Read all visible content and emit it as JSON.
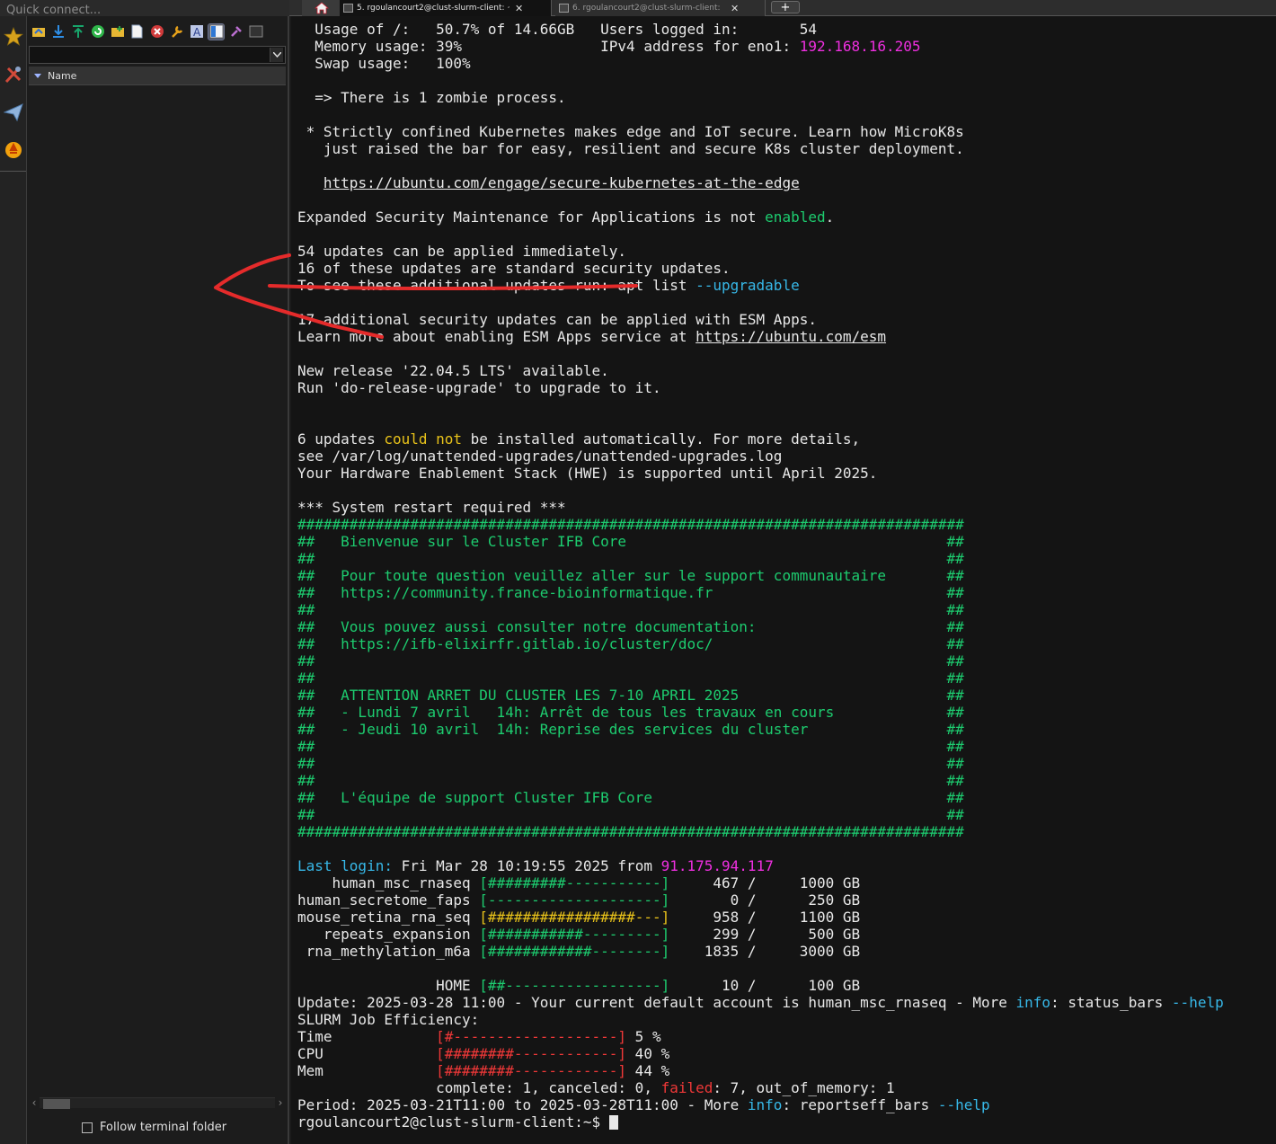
{
  "quick_connect": {
    "placeholder": "Quick connect..."
  },
  "tabs": [
    {
      "label": "5. rgoulancourt2@clust-slurm-client: ~",
      "close": "✕",
      "active": true
    },
    {
      "label": "6. rgoulancourt2@clust-slurm-client:",
      "close": "✕",
      "active": false
    }
  ],
  "new_tab_label": "+",
  "sidebar": {
    "file_list_header": "Name",
    "follow_terminal_folder": "Follow terminal folder",
    "scroll_left": "‹",
    "scroll_right": "›"
  },
  "colors": {
    "annotation_stroke": "#e52b2b",
    "terminal_green": "#1dcc6f",
    "terminal_cyan": "#37b8e8",
    "terminal_magenta": "#ef2fe0",
    "terminal_yellow": "#e8c21a",
    "terminal_red": "#ef3838"
  },
  "terminal": {
    "lines": [
      [
        {
          "t": "  Usage of /:   50.7% of 14.66GB   Users logged in:       54"
        }
      ],
      [
        {
          "t": "  Memory usage: 39%                IPv4 address for eno1: "
        },
        {
          "t": "192.168.16.205",
          "c": "magenta"
        }
      ],
      [
        {
          "t": "  Swap usage:   100%"
        }
      ],
      [
        {
          "t": ""
        }
      ],
      [
        {
          "t": "  => There is 1 zombie process."
        }
      ],
      [
        {
          "t": ""
        }
      ],
      [
        {
          "t": " * Strictly confined Kubernetes makes edge and IoT secure. Learn how MicroK8s"
        }
      ],
      [
        {
          "t": "   just raised the bar for easy, resilient and secure K8s cluster deployment."
        }
      ],
      [
        {
          "t": ""
        }
      ],
      [
        {
          "t": "   "
        },
        {
          "t": "https://ubuntu.com/engage/secure-kubernetes-at-the-edge",
          "c": "link"
        }
      ],
      [
        {
          "t": ""
        }
      ],
      [
        {
          "t": "Expanded Security Maintenance for Applications is not "
        },
        {
          "t": "enabled",
          "c": "green"
        },
        {
          "t": "."
        }
      ],
      [
        {
          "t": ""
        }
      ],
      [
        {
          "t": "54 updates can be applied immediately."
        }
      ],
      [
        {
          "t": "16 of these updates are standard security updates."
        }
      ],
      [
        {
          "t": "To see these additional updates run: apt list "
        },
        {
          "t": "--upgradable",
          "c": "cyan"
        }
      ],
      [
        {
          "t": ""
        }
      ],
      [
        {
          "t": "17 additional security updates can be applied with ESM Apps."
        }
      ],
      [
        {
          "t": "Learn more about enabling ESM Apps service at "
        },
        {
          "t": "https://ubuntu.com/esm",
          "c": "link"
        }
      ],
      [
        {
          "t": ""
        }
      ],
      [
        {
          "t": "New release '22.04.5 LTS' available."
        }
      ],
      [
        {
          "t": "Run 'do-release-upgrade' to upgrade to it."
        }
      ],
      [
        {
          "t": ""
        }
      ],
      [
        {
          "t": ""
        }
      ],
      [
        {
          "t": "6 updates "
        },
        {
          "t": "could not",
          "c": "yellow"
        },
        {
          "t": " be installed automatically. For more details,"
        }
      ],
      [
        {
          "t": "see /var/log/unattended-upgrades/unattended-upgrades.log"
        }
      ],
      [
        {
          "t": "Your Hardware Enablement Stack (HWE) is supported until April 2025."
        }
      ],
      [
        {
          "t": ""
        }
      ],
      [
        {
          "t": "*** System restart required ***"
        }
      ],
      [
        {
          "t": "#############################################################################",
          "c": "green"
        }
      ],
      [
        {
          "t": "##   Bienvenue sur le Cluster IFB Core                                     ##",
          "c": "green"
        }
      ],
      [
        {
          "t": "##                                                                         ##",
          "c": "green"
        }
      ],
      [
        {
          "t": "##   Pour toute question veuillez aller sur le support communautaire       ##",
          "c": "green"
        }
      ],
      [
        {
          "t": "##   https://community.france-bioinformatique.fr                           ##",
          "c": "green"
        }
      ],
      [
        {
          "t": "##                                                                         ##",
          "c": "green"
        }
      ],
      [
        {
          "t": "##   Vous pouvez aussi consulter notre documentation:                      ##",
          "c": "green"
        }
      ],
      [
        {
          "t": "##   https://ifb-elixirfr.gitlab.io/cluster/doc/                           ##",
          "c": "green"
        }
      ],
      [
        {
          "t": "##                                                                         ##",
          "c": "green"
        }
      ],
      [
        {
          "t": "##                                                                         ##",
          "c": "green"
        }
      ],
      [
        {
          "t": "##   ATTENTION ARRET DU CLUSTER LES 7-10 APRIL 2025                        ##",
          "c": "green"
        }
      ],
      [
        {
          "t": "##   - Lundi 7 avril   14h: Arrêt de tous les travaux en cours             ##",
          "c": "green"
        }
      ],
      [
        {
          "t": "##   - Jeudi 10 avril  14h: Reprise des services du cluster                ##",
          "c": "green"
        }
      ],
      [
        {
          "t": "##                                                                         ##",
          "c": "green"
        }
      ],
      [
        {
          "t": "##                                                                         ##",
          "c": "green"
        }
      ],
      [
        {
          "t": "##                                                                         ##",
          "c": "green"
        }
      ],
      [
        {
          "t": "##   L'équipe de support Cluster IFB Core                                  ##",
          "c": "green"
        }
      ],
      [
        {
          "t": "##                                                                         ##",
          "c": "green"
        }
      ],
      [
        {
          "t": "#############################################################################",
          "c": "green"
        }
      ],
      [
        {
          "t": ""
        }
      ],
      [
        {
          "t": "Last login:",
          "c": "cyan"
        },
        {
          "t": " Fri Mar 28 10:19:55 2025 from "
        },
        {
          "t": "91.175.94.117",
          "c": "magenta"
        }
      ],
      [
        {
          "t": "    human_msc_rnaseq "
        },
        {
          "t": "[#########-----------]",
          "c": "green"
        },
        {
          "t": "     467 /     1000 GB"
        }
      ],
      [
        {
          "t": "human_secretome_faps "
        },
        {
          "t": "[--------------------]",
          "c": "green"
        },
        {
          "t": "       0 /      250 GB"
        }
      ],
      [
        {
          "t": "mouse_retina_rna_seq "
        },
        {
          "t": "[#################---]",
          "c": "yellow"
        },
        {
          "t": "     958 /     1100 GB"
        }
      ],
      [
        {
          "t": "   repeats_expansion "
        },
        {
          "t": "[###########---------]",
          "c": "green"
        },
        {
          "t": "     299 /      500 GB"
        }
      ],
      [
        {
          "t": " rna_methylation_m6a "
        },
        {
          "t": "[############--------]",
          "c": "green"
        },
        {
          "t": "    1835 /     3000 GB"
        }
      ],
      [
        {
          "t": ""
        }
      ],
      [
        {
          "t": "                HOME "
        },
        {
          "t": "[##------------------]",
          "c": "green"
        },
        {
          "t": "      10 /      100 GB"
        }
      ],
      [
        {
          "t": "Update: 2025-03-28 11:00 - Your current default account is human_msc_rnaseq - More "
        },
        {
          "t": "info",
          "c": "cyan"
        },
        {
          "t": ": status_bars "
        },
        {
          "t": "--help",
          "c": "cyan"
        }
      ],
      [
        {
          "t": "SLURM Job Efficiency:"
        }
      ],
      [
        {
          "t": "Time            "
        },
        {
          "t": "[#-------------------]",
          "c": "red"
        },
        {
          "t": " 5 %"
        }
      ],
      [
        {
          "t": "CPU             "
        },
        {
          "t": "[########------------]",
          "c": "red"
        },
        {
          "t": " 40 %"
        }
      ],
      [
        {
          "t": "Mem             "
        },
        {
          "t": "[########------------]",
          "c": "red"
        },
        {
          "t": " 44 %"
        }
      ],
      [
        {
          "t": "                complete: 1, canceled: 0, "
        },
        {
          "t": "failed",
          "c": "red"
        },
        {
          "t": ": 7, out_of_memory: 1"
        }
      ],
      [
        {
          "t": "Period: 2025-03-21T11:00 to 2025-03-28T11:00 - More "
        },
        {
          "t": "info",
          "c": "cyan"
        },
        {
          "t": ": reportseff_bars "
        },
        {
          "t": "--help",
          "c": "cyan"
        }
      ],
      [
        {
          "t": "rgoulancourt2@clust-slurm-client:~$ "
        },
        {
          "cursor": true
        }
      ]
    ]
  }
}
